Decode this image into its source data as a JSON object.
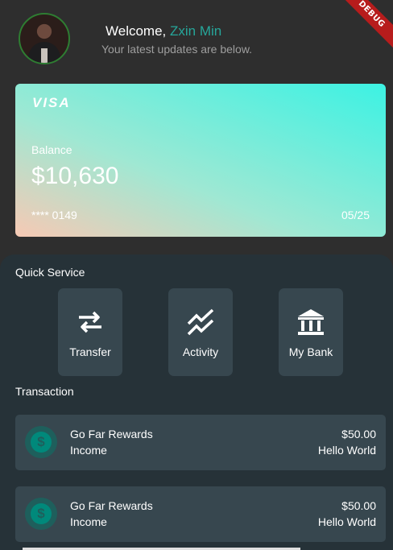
{
  "debug_banner": "DEBUG",
  "header": {
    "welcome_prefix": "Welcome,",
    "user_name": "Zxin Min",
    "subtitle": "Your latest updates are below."
  },
  "card": {
    "brand": "VISA",
    "balance_label": "Balance",
    "balance_value": "$10,630",
    "masked_number": "**** 0149",
    "expiry": "05/25"
  },
  "quick_service": {
    "title": "Quick Service",
    "items": [
      {
        "label": "Transfer",
        "icon": "swap-arrows-icon"
      },
      {
        "label": "Activity",
        "icon": "activity-chart-icon"
      },
      {
        "label": "My Bank",
        "icon": "bank-icon"
      }
    ]
  },
  "transactions": {
    "title": "Transaction",
    "items": [
      {
        "title": "Go Far Rewards",
        "type": "Income",
        "amount": "$50.00",
        "note": "Hello World",
        "icon": "dollar-coin-icon"
      },
      {
        "title": "Go Far Rewards",
        "type": "Income",
        "amount": "$50.00",
        "note": "Hello World",
        "icon": "dollar-coin-icon"
      }
    ]
  },
  "colors": {
    "background": "#2e2e2e",
    "panel": "#263238",
    "tile": "#37474f",
    "accent": "#26a69a"
  }
}
